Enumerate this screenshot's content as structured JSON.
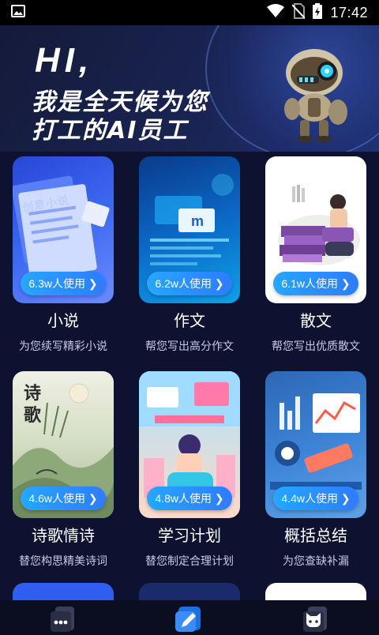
{
  "status_bar": {
    "time": "17:42",
    "icons": [
      "image-icon",
      "wifi-icon",
      "no-sim-icon",
      "battery-charging-icon"
    ]
  },
  "hero": {
    "greeting": "HI,",
    "line1": "我是全天候为您",
    "line2": "打工的AI员工",
    "robot_icon": "robot-icon"
  },
  "cards": [
    {
      "title": "小说",
      "desc": "为您续写精彩小说",
      "usage": "6.3w人使用 ❯",
      "art_text": "创意小说"
    },
    {
      "title": "作文",
      "desc": "帮您写出高分作文",
      "usage": "6.2w人使用 ❯"
    },
    {
      "title": "散文",
      "desc": "帮您写出优质散文",
      "usage": "6.1w人使用 ❯"
    },
    {
      "title": "诗歌情诗",
      "desc": "替您构思精美诗词",
      "usage": "4.6w人使用 ❯",
      "art_text": "诗歌"
    },
    {
      "title": "学习计划",
      "desc": "替您制定合理计划",
      "usage": "4.8w人使用 ❯"
    },
    {
      "title": "概括总结",
      "desc": "为您查缺补漏",
      "usage": "4.4w人使用 ❯"
    }
  ],
  "bottom_nav": {
    "items": [
      "more-icon",
      "write-icon",
      "mascot-icon"
    ]
  },
  "colors": {
    "background": "#0f1530",
    "pill_start": "#25a7ff",
    "pill_end": "#2f7bff"
  }
}
